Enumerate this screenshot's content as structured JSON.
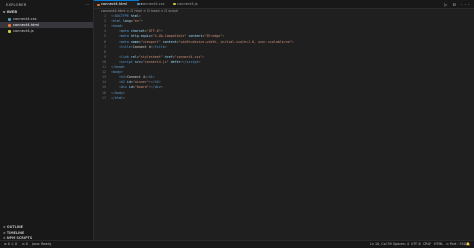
{
  "sidebar": {
    "title": "EXPLORER",
    "more": "···",
    "folder": "v IWEB",
    "files": [
      {
        "name": "connect4.css",
        "color": "#519aba",
        "selected": false
      },
      {
        "name": "connect4.html",
        "color": "#e37933",
        "selected": true
      },
      {
        "name": "connect4.js",
        "color": "#cbcb41",
        "selected": false
      }
    ],
    "sections": [
      "> OUTLINE",
      "> TIMELINE",
      "> NPM SCRIPTS"
    ]
  },
  "tabs": [
    {
      "label": "connect4.html",
      "color": "#e37933",
      "active": true,
      "close": "×"
    },
    {
      "label": "connect4.css",
      "color": "#519aba",
      "active": false
    },
    {
      "label": "connect4.js",
      "color": "#cbcb41",
      "active": false
    }
  ],
  "titlebar_actions": "▷ ⊟ ···",
  "breadcrumb": "connect4.html > ⊡ html > ⊡ head > ⊡ script",
  "code_lines": [
    {
      "n": "1",
      "segments": [
        [
          "t",
          "<!"
        ],
        [
          "tag",
          "DOCTYPE"
        ],
        [
          "at",
          " html"
        ],
        [
          "t",
          ">"
        ]
      ]
    },
    {
      "n": "2",
      "segments": [
        [
          "t",
          "<"
        ],
        [
          "tag",
          "html"
        ],
        [
          "at",
          " lang"
        ],
        [
          "tx",
          "="
        ],
        [
          "st",
          "\"en\""
        ],
        [
          "t",
          ">"
        ]
      ]
    },
    {
      "n": "3",
      "segments": [
        [
          "t",
          "<"
        ],
        [
          "tag",
          "head"
        ],
        [
          "t",
          ">"
        ]
      ]
    },
    {
      "n": "4",
      "segments": [
        [
          "tx",
          "    "
        ],
        [
          "t",
          "<"
        ],
        [
          "tag",
          "meta"
        ],
        [
          "at",
          " charset"
        ],
        [
          "tx",
          "="
        ],
        [
          "st",
          "\"UTF-8\""
        ],
        [
          "t",
          ">"
        ]
      ]
    },
    {
      "n": "5",
      "segments": [
        [
          "tx",
          "    "
        ],
        [
          "t",
          "<"
        ],
        [
          "tag",
          "meta"
        ],
        [
          "at",
          " http-equiv"
        ],
        [
          "tx",
          "="
        ],
        [
          "st",
          "\"X-UA-Compatible\""
        ],
        [
          "at",
          " content"
        ],
        [
          "tx",
          "="
        ],
        [
          "st",
          "\"IE=edge\""
        ],
        [
          "t",
          ">"
        ]
      ]
    },
    {
      "n": "6",
      "segments": [
        [
          "tx",
          "    "
        ],
        [
          "t",
          "<"
        ],
        [
          "tag",
          "meta"
        ],
        [
          "at",
          " name"
        ],
        [
          "tx",
          "="
        ],
        [
          "st",
          "\"viewport\""
        ],
        [
          "at",
          " content"
        ],
        [
          "tx",
          "="
        ],
        [
          "st",
          "\"width=device-width, initial-scale=1.0, user-scalable=no\""
        ],
        [
          "t",
          ">"
        ]
      ]
    },
    {
      "n": "7",
      "segments": [
        [
          "tx",
          "    "
        ],
        [
          "t",
          "<"
        ],
        [
          "tag",
          "title"
        ],
        [
          "t",
          ">"
        ],
        [
          "tx",
          "Connect 4"
        ],
        [
          "t",
          "</"
        ],
        [
          "tag",
          "title"
        ],
        [
          "t",
          ">"
        ]
      ]
    },
    {
      "n": "8",
      "segments": [
        [
          "tx",
          ""
        ]
      ]
    },
    {
      "n": "9",
      "segments": [
        [
          "tx",
          "    "
        ],
        [
          "t",
          "<"
        ],
        [
          "tag",
          "link"
        ],
        [
          "at",
          " rel"
        ],
        [
          "tx",
          "="
        ],
        [
          "st",
          "\"stylesheet\""
        ],
        [
          "at",
          " href"
        ],
        [
          "tx",
          "="
        ],
        [
          "st",
          "\"connect4.css\""
        ],
        [
          "t",
          ">"
        ]
      ]
    },
    {
      "n": "10",
      "segments": [
        [
          "tx",
          "    "
        ],
        [
          "t",
          "<"
        ],
        [
          "tag",
          "script"
        ],
        [
          "at",
          " src"
        ],
        [
          "tx",
          "="
        ],
        [
          "st",
          "\"connect4.js\""
        ],
        [
          "at",
          " defer"
        ],
        [
          "t",
          "></"
        ],
        [
          "tag",
          "script"
        ],
        [
          "t",
          ">"
        ]
      ]
    },
    {
      "n": "11",
      "segments": [
        [
          "t",
          "</"
        ],
        [
          "tag",
          "head"
        ],
        [
          "t",
          ">"
        ]
      ]
    },
    {
      "n": "12",
      "segments": [
        [
          "t",
          "<"
        ],
        [
          "tag",
          "body"
        ],
        [
          "t",
          ">"
        ]
      ]
    },
    {
      "n": "13",
      "segments": [
        [
          "tx",
          "    "
        ],
        [
          "t",
          "<"
        ],
        [
          "tag",
          "h1"
        ],
        [
          "t",
          ">"
        ],
        [
          "tx",
          "Connect 4"
        ],
        [
          "t",
          "</"
        ],
        [
          "tag",
          "h1"
        ],
        [
          "t",
          ">"
        ]
      ]
    },
    {
      "n": "14",
      "segments": [
        [
          "tx",
          "    "
        ],
        [
          "t",
          "<"
        ],
        [
          "tag",
          "h2"
        ],
        [
          "at",
          " id"
        ],
        [
          "tx",
          "="
        ],
        [
          "st",
          "\"winner\""
        ],
        [
          "t",
          "></"
        ],
        [
          "tag",
          "h2"
        ],
        [
          "t",
          ">"
        ]
      ]
    },
    {
      "n": "15",
      "segments": [
        [
          "tx",
          "    "
        ],
        [
          "t",
          "<"
        ],
        [
          "tag",
          "div"
        ],
        [
          "at",
          " id"
        ],
        [
          "tx",
          "="
        ],
        [
          "st",
          "\"board\""
        ],
        [
          "t",
          "></"
        ],
        [
          "tag",
          "div"
        ],
        [
          "t",
          ">"
        ]
      ]
    },
    {
      "n": "16",
      "segments": [
        [
          "t",
          "</"
        ],
        [
          "tag",
          "body"
        ],
        [
          "t",
          ">"
        ]
      ]
    },
    {
      "n": "17",
      "segments": [
        [
          "t",
          "</"
        ],
        [
          "tag",
          "html"
        ],
        [
          "t",
          ">"
        ]
      ]
    }
  ],
  "status": {
    "left": [
      "⊗ 0 ⚠ 0",
      "⊘ 0",
      "Java: Ready"
    ],
    "right": [
      "Ln 10, Col 39",
      "Spaces: 4",
      "UTF-8",
      "CRLF",
      "HTML",
      "⊙ Port : 5500",
      "🔔"
    ]
  }
}
